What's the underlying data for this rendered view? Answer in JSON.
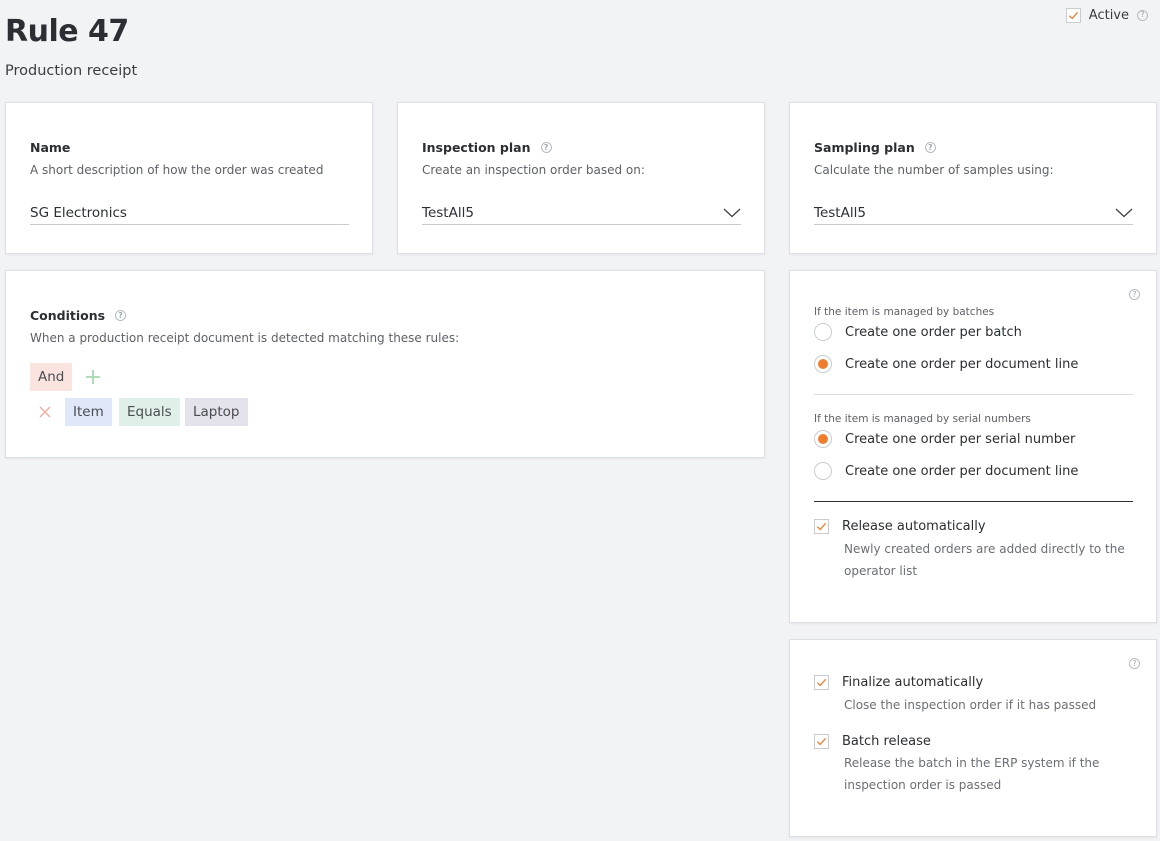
{
  "header": {
    "title": "Rule 47",
    "subtitle": "Production receipt",
    "active_label": "Active",
    "active_checked": true
  },
  "name_card": {
    "label": "Name",
    "description": "A short description of how the order was created",
    "value": "SG Electronics"
  },
  "inspection_card": {
    "label": "Inspection plan",
    "description": "Create an inspection order based on:",
    "value": "TestAll5"
  },
  "sampling_card": {
    "label": "Sampling plan",
    "description": "Calculate the number of samples using:",
    "value": "TestAll5"
  },
  "conditions_card": {
    "label": "Conditions",
    "description": "When a production receipt document is detected matching these rules:",
    "operator": "And",
    "rule": {
      "field": "Item",
      "comparator": "Equals",
      "value": "Laptop"
    }
  },
  "order_card": {
    "batches_heading": "If the item is managed by batches",
    "batch_options": [
      "Create one order per batch",
      "Create one order per document line"
    ],
    "batch_selected": 1,
    "serial_heading": "If the item is managed by serial numbers",
    "serial_options": [
      "Create one order per serial number",
      "Create one order per document line"
    ],
    "serial_selected": 0,
    "release": {
      "label": "Release automatically",
      "description_line1": "Newly created orders are added directly to the",
      "description_line2": "operator list",
      "checked": true
    }
  },
  "finalize_card": {
    "finalize": {
      "label": "Finalize automatically",
      "description": "Close the inspection order if it has passed",
      "checked": true
    },
    "batch_release": {
      "label": "Batch release",
      "description_line1": "Release the batch in the ERP system if the",
      "description_line2": "inspection order is passed",
      "checked": true
    }
  },
  "colors": {
    "accent": "#ef7d2d",
    "page_bg": "#f2f3f5",
    "tag_and": "#fbe4e0",
    "tag_item": "#dfe7f8",
    "tag_equals": "#e0efe8",
    "tag_laptop": "#e4e2ea"
  },
  "icons": {
    "help": "help-circle-icon",
    "check": "checkmark-icon",
    "chevron": "chevron-down-icon",
    "add": "plus-icon",
    "remove": "close-icon"
  }
}
